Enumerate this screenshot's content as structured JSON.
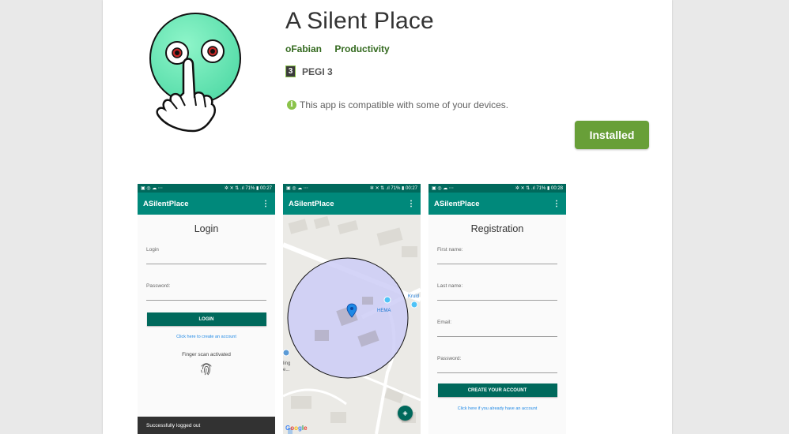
{
  "app": {
    "title": "A Silent Place",
    "developer": "oFabian",
    "category": "Productivity",
    "rating_badge": "3",
    "rating_text": "PEGI 3",
    "compatibility": "This app is compatible with some of your devices.",
    "install_label": "Installed",
    "accent_color": "#689f38"
  },
  "screenshots": [
    {
      "status_left": "▣ ◎ ☁ ⋯",
      "status_right": "✲ ✕ ⇅ .ıl 71% ▮ 00:27",
      "app_title": "ASilentPlace",
      "screen_title": "Login",
      "fields": [
        "Login",
        "Password:"
      ],
      "button": "LOGIN",
      "link": "Click here to create an account",
      "finger_text": "Finger scan activated",
      "snackbar": "Successfully logged out"
    },
    {
      "status_left": "▣ ◎ ☁ ⋯",
      "status_right": "✲ ✕ ⇅ .ıl 71% ▮ 00:27",
      "app_title": "ASilentPlace",
      "map_label": "HEMA",
      "map_left_text": "ling",
      "map_left_text2": "e...",
      "map_right_text": "Kruid",
      "google": "Google"
    },
    {
      "status_left": "▣ ◎ ☁ ⋯",
      "status_right": "✲ ✕ ⇅ .ıl 71% ▮ 00:28",
      "app_title": "ASilentPlace",
      "screen_title": "Registration",
      "fields": [
        "First name:",
        "Last name:",
        "Email:",
        "Password:"
      ],
      "button": "CREATE YOUR ACCOUNT",
      "link": "Click here if you already have an account"
    }
  ]
}
